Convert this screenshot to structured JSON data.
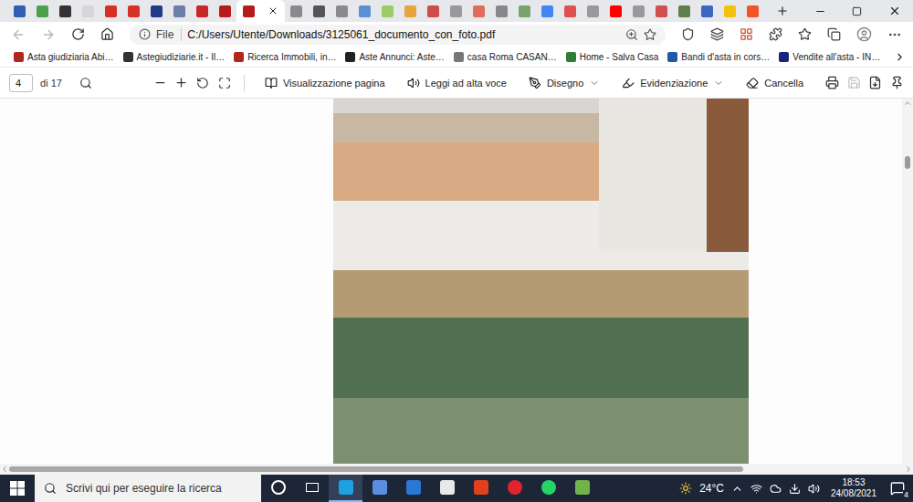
{
  "browser": {
    "tabs": [
      {
        "color": "#2f5fb3",
        "selected": false
      },
      {
        "color": "#4aa14a",
        "selected": false
      },
      {
        "color": "#333333",
        "selected": false
      },
      {
        "color": "#d6d6d6",
        "selected": false
      },
      {
        "color": "#d93025",
        "selected": false
      },
      {
        "color": "#d93025",
        "selected": false
      },
      {
        "color": "#1e3a8a",
        "selected": false
      },
      {
        "color": "#6b7fa8",
        "selected": false
      },
      {
        "color": "#c62828",
        "selected": false
      },
      {
        "color": "#b71c1c",
        "selected": false
      },
      {
        "color": "#b71c1c",
        "selected": true
      },
      {
        "color": "#8a8a8a",
        "selected": false
      },
      {
        "color": "#555555",
        "selected": false
      },
      {
        "color": "#8a8a8a",
        "selected": false
      },
      {
        "color": "#5b8fd6",
        "selected": false
      },
      {
        "color": "#9ccc65",
        "selected": false
      },
      {
        "color": "#e8a33d",
        "selected": false
      },
      {
        "color": "#d24b4b",
        "selected": false
      },
      {
        "color": "#999999",
        "selected": false
      },
      {
        "color": "#e06c5b",
        "selected": false
      },
      {
        "color": "#888888",
        "selected": false
      },
      {
        "color": "#7aa36b",
        "selected": false
      },
      {
        "color": "#4285f4",
        "selected": false
      },
      {
        "color": "#e05050",
        "selected": false
      },
      {
        "color": "#999999",
        "selected": false
      },
      {
        "color": "#ff0000",
        "selected": false
      },
      {
        "color": "#999999",
        "selected": false
      },
      {
        "color": "#d05050",
        "selected": false
      },
      {
        "color": "#5f7e4f",
        "selected": false
      },
      {
        "color": "#3d66c7",
        "selected": false
      },
      {
        "color": "#f4c20d",
        "selected": false
      },
      {
        "color": "#f35325",
        "selected": false
      }
    ],
    "nav": {
      "back_disabled": true,
      "forward_disabled": true
    },
    "address_bar": {
      "scheme_label": "File",
      "url": "C:/Users/Utente/Downloads/3125061_documento_con_foto.pdf"
    },
    "favorites": [
      {
        "label": "Asta giudiziaria Abi…",
        "color": "#b3261e"
      },
      {
        "label": "Astegiudiziarie.it - Il…",
        "color": "#333333"
      },
      {
        "label": "Ricerca Immobili, in…",
        "color": "#b3261e"
      },
      {
        "label": "Aste Annunci: Aste…",
        "color": "#222222"
      },
      {
        "label": "casa Roma CASAN…",
        "color": "#777777"
      },
      {
        "label": "Home - Salva Casa",
        "color": "#2e7d32"
      },
      {
        "label": "Bandi d'asta in cors…",
        "color": "#1e5aa8"
      },
      {
        "label": "Vendite all'asta - IN…",
        "color": "#1a237e"
      }
    ]
  },
  "pdf_toolbar": {
    "page": "4",
    "page_count": "di 17",
    "save_disabled": true,
    "tools": [
      {
        "kind": "view",
        "label": "Visualizzazione pagina",
        "has_menu": false
      },
      {
        "kind": "read",
        "label": "Leggi ad alta voce",
        "has_menu": false
      },
      {
        "kind": "draw",
        "label": "Disegno",
        "has_menu": true
      },
      {
        "kind": "highlight",
        "label": "Evidenziazione",
        "has_menu": true
      },
      {
        "kind": "erase",
        "label": "Cancella",
        "has_menu": false
      }
    ]
  },
  "document": {
    "vertical_scroll_position": 0.14,
    "horizontal_scroll_level": 0.82
  },
  "taskbar": {
    "search_placeholder": "Scrivi qui per eseguire la ricerca",
    "apps": [
      {
        "kind": "circle",
        "color": "#ffffff",
        "selected": false
      },
      {
        "kind": "taskview",
        "color": "#ffffff",
        "selected": false
      },
      {
        "kind": "tile",
        "color": "#1fa0e0",
        "selected": true
      },
      {
        "kind": "tile",
        "color": "#5a8de0",
        "selected": false
      },
      {
        "kind": "tile",
        "color": "#2b78d4",
        "selected": false
      },
      {
        "kind": "tile",
        "color": "#e8e8e8",
        "selected": false
      },
      {
        "kind": "tile",
        "color": "#e2401c",
        "selected": false
      },
      {
        "kind": "circle",
        "color": "#e0242f",
        "selected": false
      },
      {
        "kind": "circle",
        "color": "#25d366",
        "selected": false
      },
      {
        "kind": "tile",
        "color": "#6fb34a",
        "selected": false
      }
    ],
    "weather": "24°C",
    "time": "18:53",
    "date": "24/08/2021",
    "notification_count": "4"
  }
}
